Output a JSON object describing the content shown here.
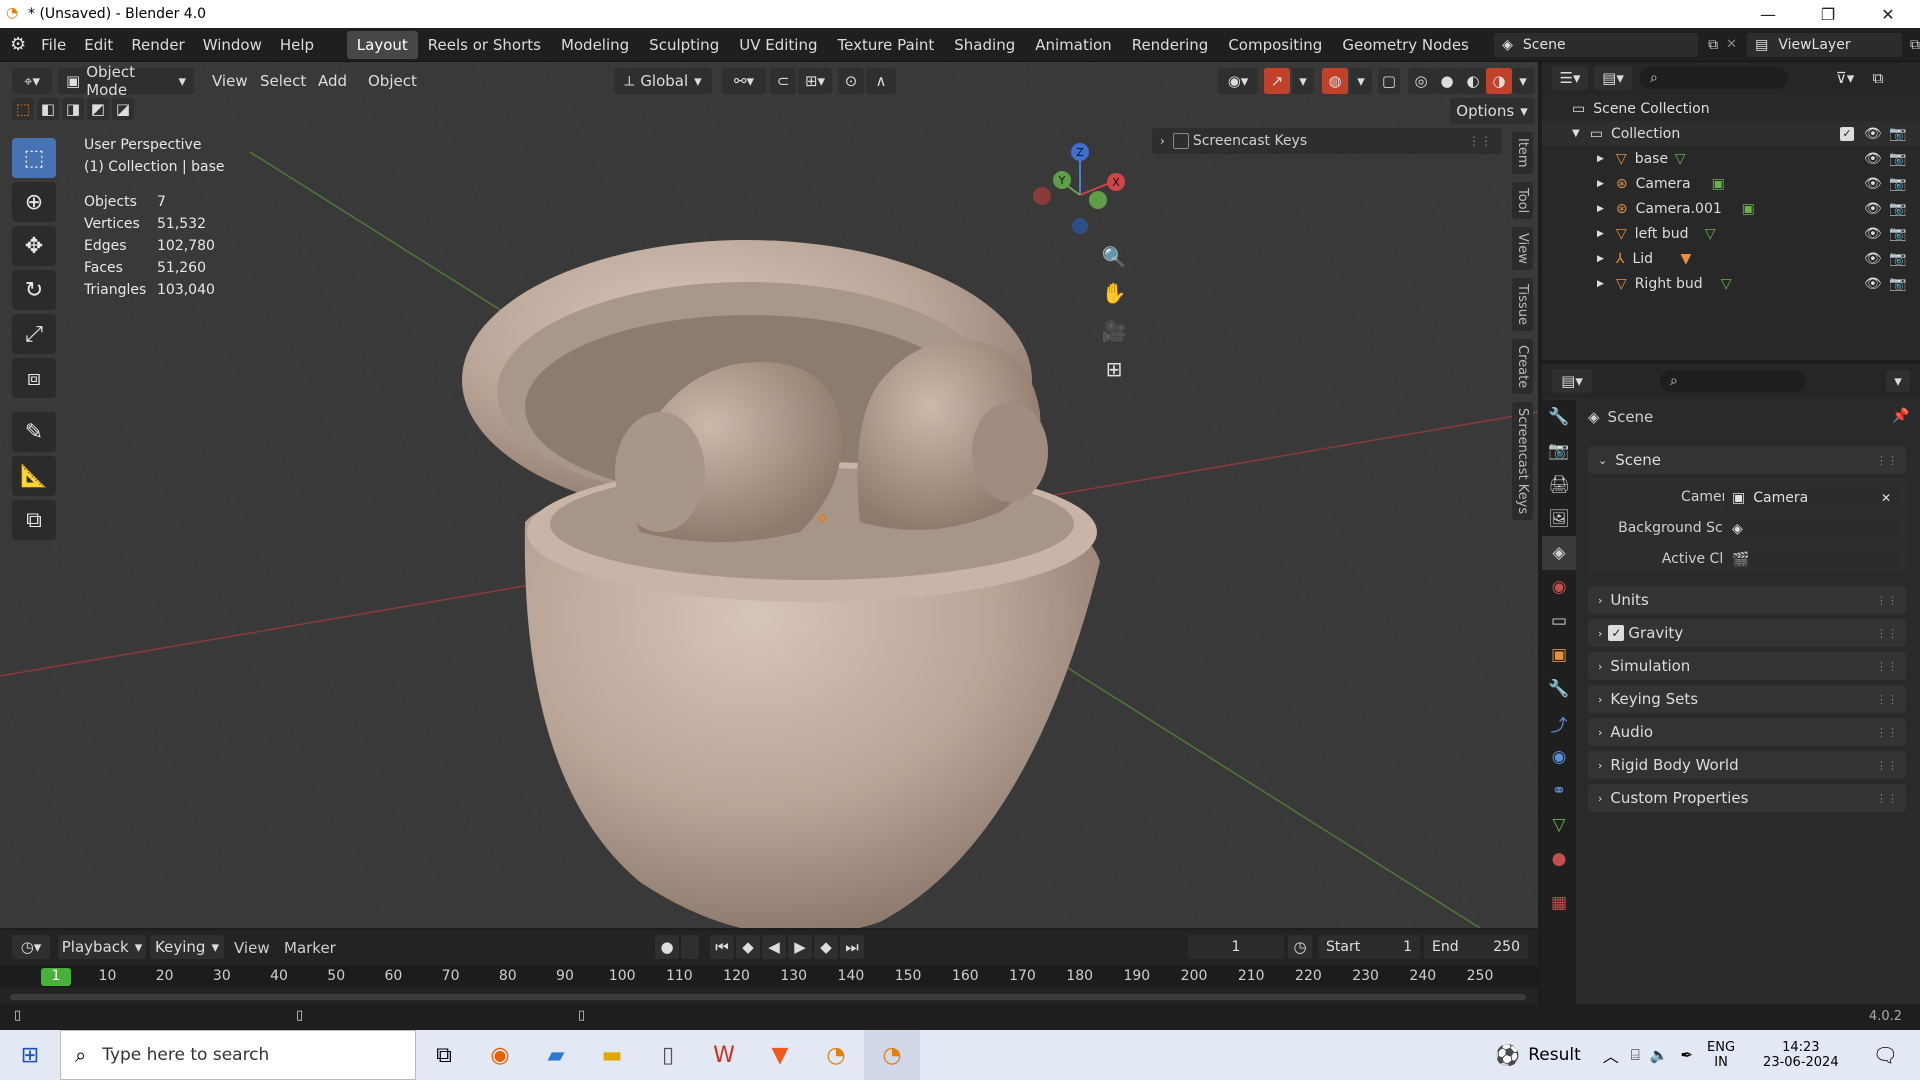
{
  "window": {
    "title": "* (Unsaved) - Blender 4.0"
  },
  "menus": [
    "File",
    "Edit",
    "Render",
    "Window",
    "Help"
  ],
  "workspaces": [
    "Layout",
    "Reels or Shorts",
    "Modeling",
    "Sculpting",
    "UV Editing",
    "Texture Paint",
    "Shading",
    "Animation",
    "Rendering",
    "Compositing",
    "Geometry Nodes"
  ],
  "active_workspace": "Layout",
  "scene_selector": "Scene",
  "viewlayer_selector": "ViewLayer",
  "viewport": {
    "mode": "Object Mode",
    "menus": [
      "View",
      "Select",
      "Add",
      "Object"
    ],
    "orientation": "Global",
    "options_label": "Options",
    "perspective": "User Perspective",
    "collection_info": "(1) Collection | base",
    "stats": [
      {
        "label": "Objects",
        "value": "7"
      },
      {
        "label": "Vertices",
        "value": "51,532"
      },
      {
        "label": "Edges",
        "value": "102,780"
      },
      {
        "label": "Faces",
        "value": "51,260"
      },
      {
        "label": "Triangles",
        "value": "103,040"
      }
    ],
    "gizmo": {
      "x": "X",
      "y": "Y",
      "z": "Z"
    },
    "screencast_panel": "Screencast Keys",
    "side_tabs": [
      "Item",
      "Tool",
      "View",
      "Tissue",
      "Create",
      "Screencast Keys"
    ]
  },
  "outliner": {
    "root": "Scene Collection",
    "collection": "Collection",
    "items": [
      {
        "name": "base",
        "icon": "mesh-icon"
      },
      {
        "name": "Camera",
        "icon": "camera-icon"
      },
      {
        "name": "Camera.001",
        "icon": "camera-icon"
      },
      {
        "name": "left bud",
        "icon": "mesh-icon"
      },
      {
        "name": "Lid",
        "icon": "armature-icon"
      },
      {
        "name": "Right bud",
        "icon": "mesh-icon"
      }
    ]
  },
  "properties": {
    "header": "Scene",
    "section": "Scene",
    "fields": [
      {
        "label": "Camera",
        "value": "Camera"
      },
      {
        "label": "Background Sc...",
        "value": ""
      },
      {
        "label": "Active Clip",
        "value": ""
      }
    ],
    "panels": [
      "Units",
      "Gravity",
      "Simulation",
      "Keying Sets",
      "Audio",
      "Rigid Body World",
      "Custom Properties"
    ]
  },
  "timeline": {
    "menus": [
      "Playback",
      "Keying",
      "View",
      "Marker"
    ],
    "current_frame": "1",
    "start_label": "Start",
    "start": "1",
    "end_label": "End",
    "end": "250",
    "ruler": [
      "1",
      "10",
      "20",
      "30",
      "40",
      "50",
      "60",
      "70",
      "80",
      "90",
      "100",
      "110",
      "120",
      "130",
      "140",
      "150",
      "160",
      "170",
      "180",
      "190",
      "200",
      "210",
      "220",
      "230",
      "240",
      "250"
    ]
  },
  "statusbar": {
    "version": "4.0.2"
  },
  "taskbar": {
    "search_placeholder": "Type here to search",
    "weather": "Result",
    "lang": "ENG",
    "region": "IN",
    "time": "14:23",
    "date": "23-06-2024"
  }
}
